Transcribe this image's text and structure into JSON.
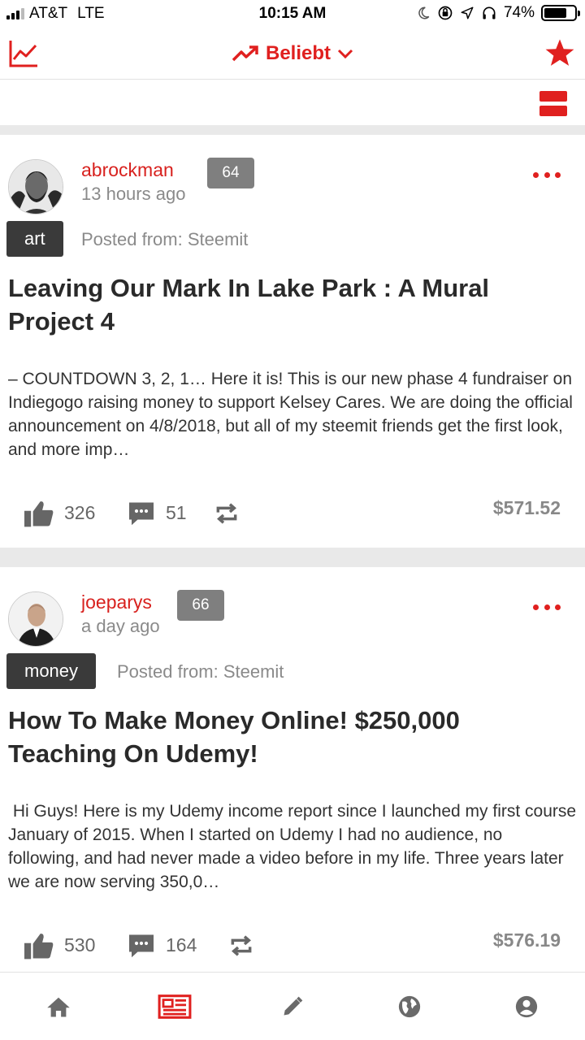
{
  "status_bar": {
    "carrier": "AT&T",
    "network": "LTE",
    "time": "10:15 AM",
    "battery_percent": "74%",
    "battery_level": 0.74,
    "icons": [
      "signal-icon",
      "moon-icon",
      "orientation-lock-icon",
      "location-arrow-icon",
      "headphones-icon",
      "battery-icon"
    ]
  },
  "top_nav": {
    "sort_label": "Beliebt",
    "icons": [
      "trending-chart-icon",
      "trending-arrow-icon",
      "chevron-down-icon",
      "star-icon"
    ]
  },
  "colors": {
    "accent": "#e0201f",
    "author": "#d8211e",
    "tag_bg": "#3a3a3a",
    "rep_bg": "#7f7f7f",
    "muted": "#8a8a8a",
    "divider": "#e9e9e9"
  },
  "posts": [
    {
      "author": "abrockman",
      "reputation": "64",
      "time": "13 hours ago",
      "tag": "art",
      "posted_from": "Posted from: Steemit",
      "title": "Leaving Our Mark In Lake Park : A Mural Project 4",
      "excerpt": "– COUNTDOWN 3, 2, 1… Here it is! This is our new phase 4 fundraiser on Indiegogo raising money to support Kelsey Cares. We are doing the official announcement on 4/8/2018, but all of my steemit friends get the first look, and more imp…",
      "votes": "326",
      "comments": "51",
      "payout": "$571.52"
    },
    {
      "author": "joeparys",
      "reputation": "66",
      "time": "a day ago",
      "tag": "money",
      "posted_from": "Posted from: Steemit",
      "title": "How To Make Money Online! $250,000 Teaching On Udemy!",
      "excerpt": " Hi Guys! Here is my Udemy income report since I launched my first course January of 2015. When I started on Udemy I had no audience, no following, and had never made a video before in my life. Three years later we are now serving 350,0…",
      "votes": "530",
      "comments": "164",
      "payout": "$576.19"
    }
  ],
  "bottom_nav": {
    "tabs": [
      "home-icon",
      "news-feed-icon",
      "pencil-icon",
      "globe-icon",
      "user-account-icon"
    ],
    "active": "news-feed-icon"
  }
}
